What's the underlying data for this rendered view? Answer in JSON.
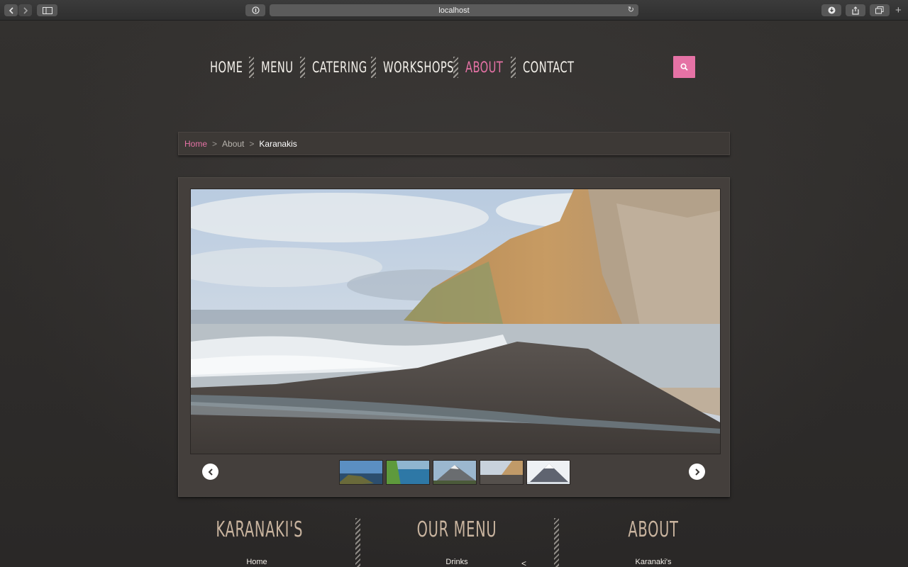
{
  "browser": {
    "url": "localhost"
  },
  "nav": {
    "items": [
      {
        "label": "Home",
        "active": false
      },
      {
        "label": "Menu",
        "active": false
      },
      {
        "label": "Catering",
        "active": false
      },
      {
        "label": "Workshops",
        "active": false
      },
      {
        "label": "About",
        "active": true
      },
      {
        "label": "Contact",
        "active": false
      }
    ],
    "accent_color": "#e572a5"
  },
  "breadcrumb": {
    "home": "Home",
    "separator": ">",
    "parent": "About",
    "current": "Karanakis"
  },
  "gallery": {
    "main_image_alt": "",
    "thumbnail_count": 5
  },
  "footer": {
    "columns": [
      {
        "title": "Karanaki's",
        "first_link": "Home"
      },
      {
        "title": "Our Menu",
        "first_link": "Drinks"
      },
      {
        "title": "About",
        "first_link": "Karanaki's"
      }
    ],
    "stray_glyph": "<"
  }
}
